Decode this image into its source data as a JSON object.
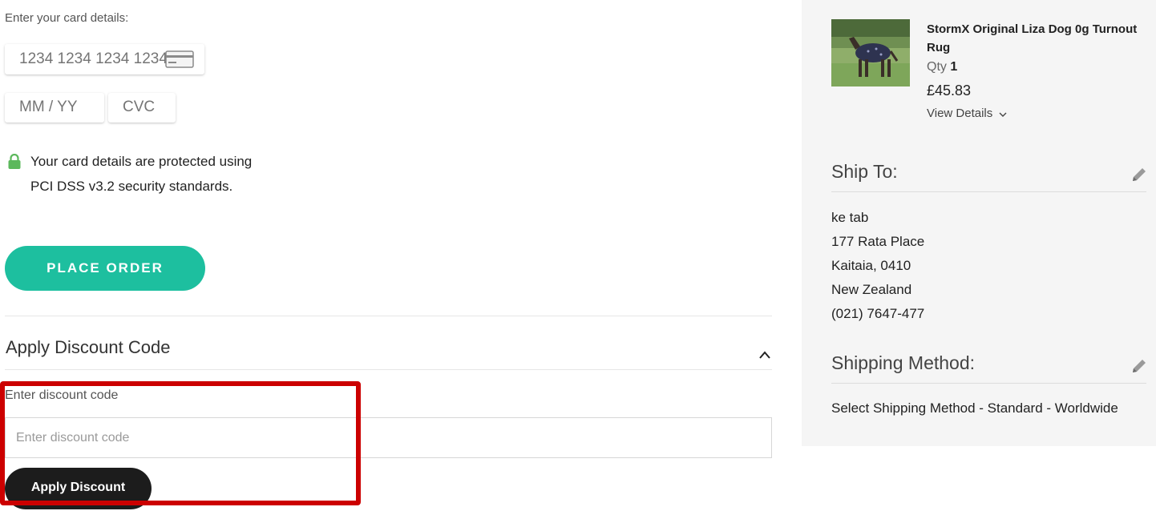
{
  "payment": {
    "card_details_label": "Enter your card details:",
    "card_number_placeholder": "1234 1234 1234 1234",
    "expiry_placeholder": "MM / YY",
    "cvc_placeholder": "CVC",
    "security_line1": "Your card details are protected using",
    "security_line2": "PCI DSS v3.2 security standards.",
    "place_order_label": "PLACE ORDER"
  },
  "discount": {
    "section_title": "Apply Discount Code",
    "field_label": "Enter discount code",
    "input_placeholder": "Enter discount code",
    "input_value": "",
    "apply_label": "Apply Discount"
  },
  "sidebar": {
    "product": {
      "name": "StormX Original Liza Dog 0g Turnout Rug",
      "qty_label": "Qty",
      "qty_value": "1",
      "price": "£45.83",
      "view_details": "View Details"
    },
    "ship_to": {
      "title": "Ship To:",
      "lines": [
        "ke tab",
        "177 Rata Place",
        "Kaitaia, 0410",
        "New Zealand",
        "(021) 7647-477"
      ]
    },
    "shipping_method": {
      "title": "Shipping Method:",
      "value": "Select Shipping Method - Standard - Worldwide"
    }
  },
  "colors": {
    "accent_teal": "#1dbf9f",
    "button_dark": "#1c1c1c",
    "highlight_red": "#cc0000",
    "lock_green": "#5cb85c",
    "sidebar_bg": "#f5f5f5"
  },
  "icons": {
    "card_brand": "credit-card-icon",
    "lock": "lock-icon",
    "collapse": "chevron-up-icon",
    "expand": "chevron-down-icon",
    "edit": "pencil-icon"
  }
}
